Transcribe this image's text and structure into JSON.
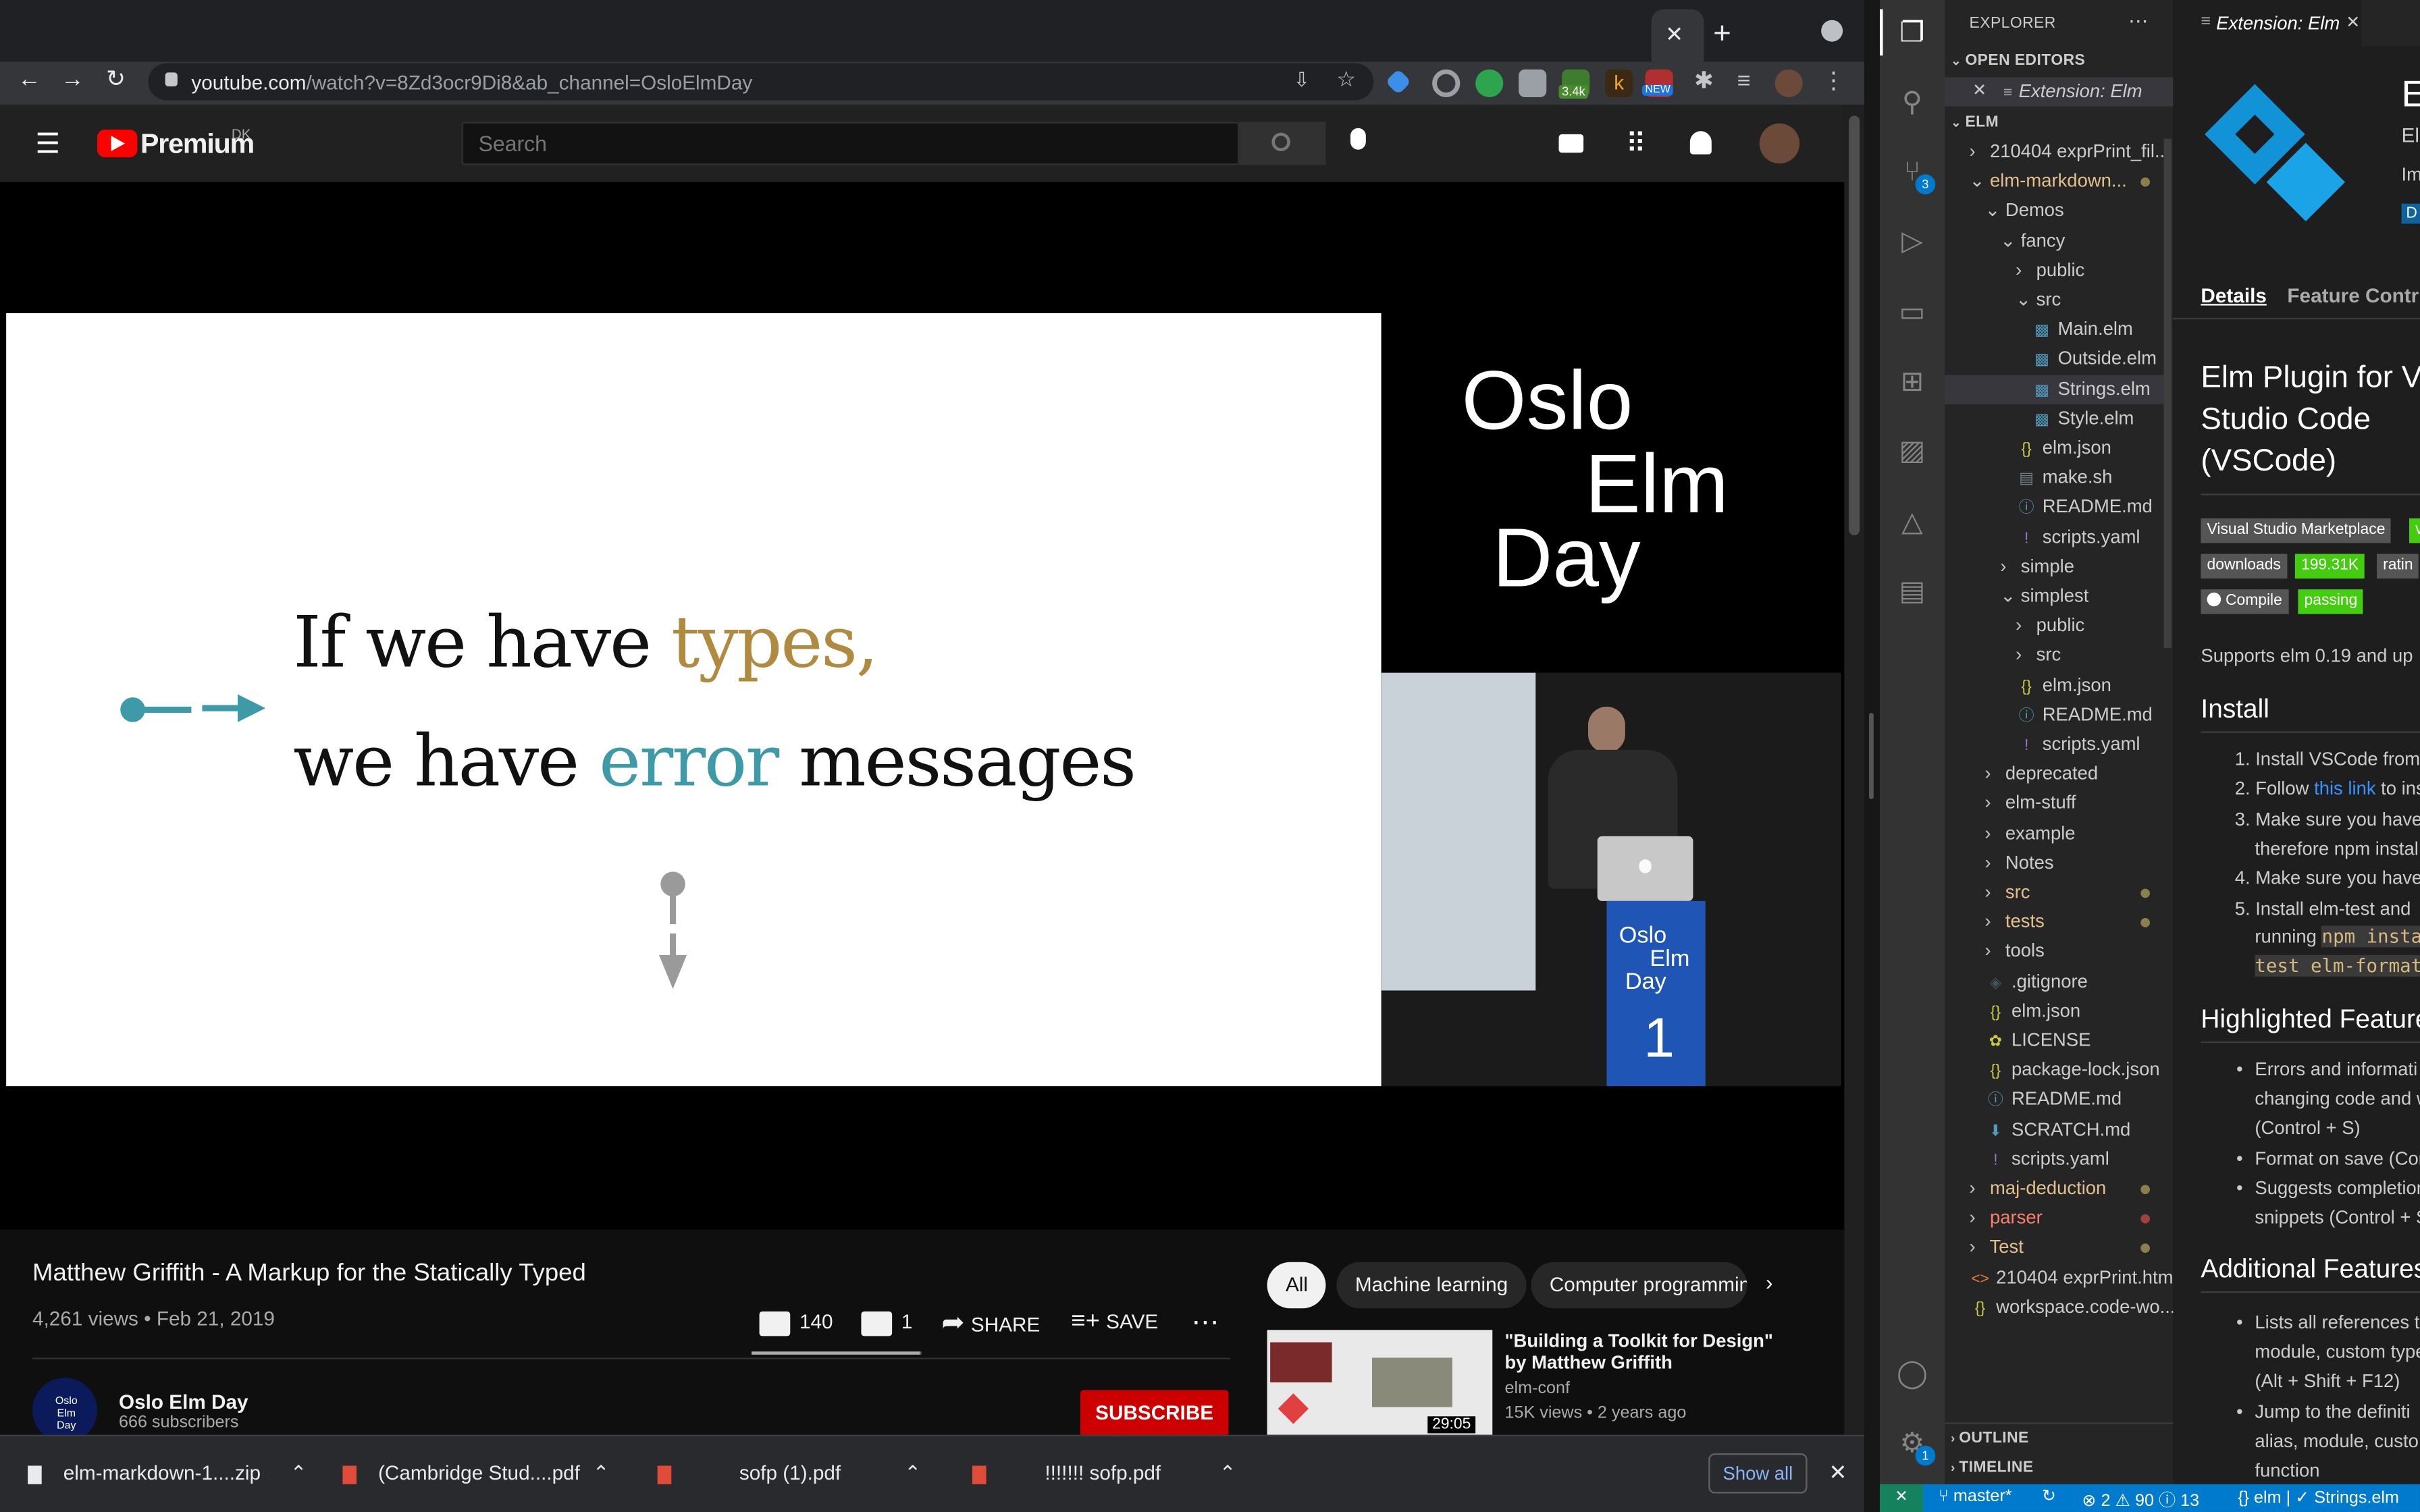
{
  "browser": {
    "url_host": "youtube.com",
    "url_path": "/watch?v=8Zd3ocr9Di8&ab_channel=OsloElmDay",
    "ext_badges": {
      "counter": "3.4k",
      "new": "NEW"
    }
  },
  "youtube": {
    "logo_text": "Premium",
    "logo_region": "DK",
    "search_placeholder": "Search",
    "video": {
      "title": "Matthew Griffith - A Markup for the Statically Typed",
      "views_date": "4,261 views • Feb 21, 2019",
      "likes": "140",
      "dislikes": "1",
      "share_label": "SHARE",
      "save_label": "SAVE"
    },
    "channel": {
      "name": "Oslo Elm Day",
      "subscribers": "666 subscribers",
      "subscribe_label": "SUBSCRIBE",
      "avatar_text": "Oslo Elm Day"
    },
    "slide": {
      "line1_a": "If we have ",
      "line1_b": "types,",
      "line2_a": "we have ",
      "line2_b": "error",
      "line2_c": " messages"
    },
    "logo_overlay": {
      "line1": "Oslo",
      "line2": "Elm",
      "line3": "Day"
    },
    "podium": {
      "line1": "Oslo",
      "line2": "Elm",
      "line3": "Day",
      "number": "1"
    },
    "chips": [
      "All",
      "Machine learning",
      "Computer programmin"
    ],
    "recommended": {
      "title": "\"Building a Toolkit for Design\" by Matthew Griffith",
      "channel": "elm-conf",
      "meta": "15K views • 2 years ago",
      "duration": "29:05"
    }
  },
  "downloads": {
    "items": [
      "elm-markdown-1....zip",
      "(Cambridge Stud....pdf",
      "sofp (1).pdf",
      "!!!!!!! sofp.pdf"
    ],
    "show_all": "Show all"
  },
  "vscode": {
    "explorer_title": "EXPLORER",
    "open_editors_label": "OPEN EDITORS",
    "open_editor_item": "Extension: Elm",
    "folder_label": "ELM",
    "tree": [
      {
        "label": "210404 exprPrint_fil...",
        "indent": 0,
        "kind": "folder-closed"
      },
      {
        "label": "elm-markdown...",
        "indent": 0,
        "kind": "folder-open",
        "modified": true
      },
      {
        "label": "Demos",
        "indent": 1,
        "kind": "folder-open"
      },
      {
        "label": "fancy",
        "indent": 2,
        "kind": "folder-open"
      },
      {
        "label": "public",
        "indent": 3,
        "kind": "folder-closed"
      },
      {
        "label": "src",
        "indent": 3,
        "kind": "folder-open"
      },
      {
        "label": "Main.elm",
        "indent": 4,
        "kind": "elm"
      },
      {
        "label": "Outside.elm",
        "indent": 4,
        "kind": "elm"
      },
      {
        "label": "Strings.elm",
        "indent": 4,
        "kind": "elm",
        "selected": true
      },
      {
        "label": "Style.elm",
        "indent": 4,
        "kind": "elm"
      },
      {
        "label": "elm.json",
        "indent": 3,
        "kind": "json"
      },
      {
        "label": "make.sh",
        "indent": 3,
        "kind": "sh"
      },
      {
        "label": "README.md",
        "indent": 3,
        "kind": "info"
      },
      {
        "label": "scripts.yaml",
        "indent": 3,
        "kind": "yaml"
      },
      {
        "label": "simple",
        "indent": 2,
        "kind": "folder-closed"
      },
      {
        "label": "simplest",
        "indent": 2,
        "kind": "folder-open"
      },
      {
        "label": "public",
        "indent": 3,
        "kind": "folder-closed"
      },
      {
        "label": "src",
        "indent": 3,
        "kind": "folder-closed"
      },
      {
        "label": "elm.json",
        "indent": 3,
        "kind": "json"
      },
      {
        "label": "README.md",
        "indent": 3,
        "kind": "info"
      },
      {
        "label": "scripts.yaml",
        "indent": 3,
        "kind": "yaml"
      },
      {
        "label": "deprecated",
        "indent": 1,
        "kind": "folder-closed"
      },
      {
        "label": "elm-stuff",
        "indent": 1,
        "kind": "folder-closed"
      },
      {
        "label": "example",
        "indent": 1,
        "kind": "folder-closed"
      },
      {
        "label": "Notes",
        "indent": 1,
        "kind": "folder-closed"
      },
      {
        "label": "src",
        "indent": 1,
        "kind": "folder-closed",
        "modified": true
      },
      {
        "label": "tests",
        "indent": 1,
        "kind": "folder-closed",
        "modified": true
      },
      {
        "label": "tools",
        "indent": 1,
        "kind": "folder-closed"
      },
      {
        "label": ".gitignore",
        "indent": 1,
        "kind": "git"
      },
      {
        "label": "elm.json",
        "indent": 1,
        "kind": "json"
      },
      {
        "label": "LICENSE",
        "indent": 1,
        "kind": "license"
      },
      {
        "label": "package-lock.json",
        "indent": 1,
        "kind": "json"
      },
      {
        "label": "README.md",
        "indent": 1,
        "kind": "info"
      },
      {
        "label": "SCRATCH.md",
        "indent": 1,
        "kind": "md"
      },
      {
        "label": "scripts.yaml",
        "indent": 1,
        "kind": "yaml"
      },
      {
        "label": "maj-deduction",
        "indent": 0,
        "kind": "folder-closed",
        "modified": true
      },
      {
        "label": "parser",
        "indent": 0,
        "kind": "folder-closed",
        "modified": true,
        "error": true
      },
      {
        "label": "Test",
        "indent": 0,
        "kind": "folder-closed",
        "modified": true
      },
      {
        "label": "210404 exprPrint.html",
        "indent": 0,
        "kind": "html"
      },
      {
        "label": "workspace.code-wo...",
        "indent": 0,
        "kind": "json"
      }
    ],
    "outline_label": "OUTLINE",
    "timeline_label": "TIMELINE",
    "scm_badge": "3",
    "settings_badge": "1",
    "tab_label": "Extension: Elm",
    "ext_header_letter": "E",
    "ext_header_line2": "El",
    "ext_header_line3": "Im",
    "ext_header_button": "D",
    "tabs": {
      "details": "Details",
      "contrib": "Feature Contri"
    },
    "readme": {
      "title": [
        "Elm Plugin for V",
        "Studio Code",
        "(VSCode)"
      ],
      "badges": [
        {
          "left": "Visual Studio Marketplace",
          "right": "v"
        },
        {
          "left": "downloads",
          "right": "199.31K"
        },
        {
          "left": "ratin",
          "right": ""
        },
        {
          "left": "Compile",
          "right": "passing"
        }
      ],
      "supports": "Supports elm 0.19 and up",
      "install_heading": "Install",
      "install_items": [
        "1. Install VSCode from",
        "2. Follow ",
        "3. Make sure you have",
        "therefore npm instal",
        "4. Make sure you have",
        "5. Install elm-test and",
        "running "
      ],
      "install_link": "this link",
      "install_link_rest": " to ins",
      "code1": "npm insta",
      "code2": "test elm-format",
      "highlighted_heading": "Highlighted Feature",
      "highlighted_items": [
        "Errors and informati",
        "changing code and w",
        "(Control + S)",
        "Format on save (Con",
        "Suggests completion",
        "snippets (Control + S"
      ],
      "additional_heading": "Additional Features",
      "additional_items": [
        "Lists all references t",
        "module, custom type",
        "(Alt + Shift + F12)",
        "Jump to the definiti",
        "alias, module, custo",
        "function"
      ]
    },
    "status": {
      "branch": "master*",
      "errors": "2",
      "warnings": "90",
      "info": "13",
      "language": "elm",
      "file": "Strings.elm"
    }
  },
  "colors": {
    "youtube_red": "#ff0000",
    "subscribe_red": "#cc0000",
    "slide_gold": "#b08a3e",
    "slide_teal": "#3f9aa8",
    "vscode_blue": "#007acc",
    "elm_blue": "#1293d8"
  }
}
